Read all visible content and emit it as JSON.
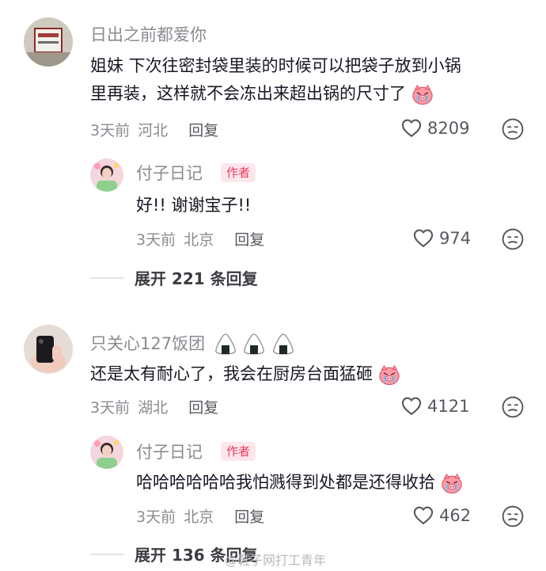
{
  "comments": [
    {
      "username": "日出之前都爱你",
      "line1": "姐妹 下次往密封袋里装的时候可以把袋子放到小锅",
      "line2": "里再装，这样就不会冻出来超出锅的尺寸了",
      "time": "3天前",
      "location": "河北",
      "reply_label": "回复",
      "likes": "8209",
      "emoji": "crying-pig-emoji",
      "replies": [
        {
          "username": "付子日记",
          "badge": "作者",
          "text": "好!!  谢谢宝子!!",
          "time": "3天前",
          "location": "北京",
          "reply_label": "回复",
          "likes": "974"
        }
      ],
      "expand_label": "展开 221 条回复"
    },
    {
      "username": "只关心127饭团",
      "name_emojis": [
        "onigiri-emoji",
        "onigiri-emoji",
        "onigiri-emoji"
      ],
      "text": "还是太有耐心了，我会在厨房台面猛砸",
      "time": "3天前",
      "location": "湖北",
      "reply_label": "回复",
      "likes": "4121",
      "emoji": "crying-pig-emoji",
      "replies": [
        {
          "username": "付子日记",
          "badge": "作者",
          "text": "哈哈哈哈哈哈我怕溅得到处都是还得收拾",
          "time": "3天前",
          "location": "北京",
          "reply_label": "回复",
          "likes": "462",
          "emoji": "crying-pig-emoji"
        }
      ],
      "expand_label": "展开 136 条回复"
    }
  ],
  "watermark": "@鞋子网打工青年",
  "colors": {
    "author_badge_text": "#ee3a5d",
    "author_badge_bg": "#fde7ec",
    "muted": "#8a8b91"
  }
}
